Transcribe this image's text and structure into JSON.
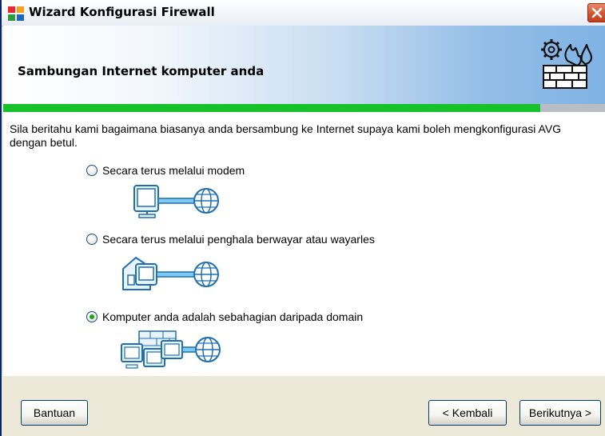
{
  "window": {
    "title": "Wizard Konfigurasi Firewall"
  },
  "header": {
    "title": "Sambungan Internet komputer anda",
    "icon": "firewall-gear-icon"
  },
  "progress": {
    "value": 0.89,
    "fill_color": "#17c12a"
  },
  "content": {
    "intro": "Sila beritahu kami bagaimana biasanya anda bersambung ke Internet supaya kami boleh mengkonfigurasi AVG dengan betul.",
    "options": [
      {
        "label": "Secara terus melalui modem",
        "selected": false,
        "icon": "computer-modem-internet-icon"
      },
      {
        "label": "Secara terus melalui penghala berwayar atau wayarles",
        "selected": false,
        "icon": "router-computer-internet-icon"
      },
      {
        "label": "Komputer anda adalah sebahagian daripada domain",
        "selected": true,
        "icon": "domain-network-internet-icon"
      }
    ]
  },
  "footer": {
    "help_label": "Bantuan",
    "back_label": "< Kembali",
    "next_label": "Berikutnya >"
  },
  "colors": {
    "title_close": "#d6532f",
    "header_gradient_end": "#7fb2e4",
    "radio_selected": "#21a121"
  }
}
